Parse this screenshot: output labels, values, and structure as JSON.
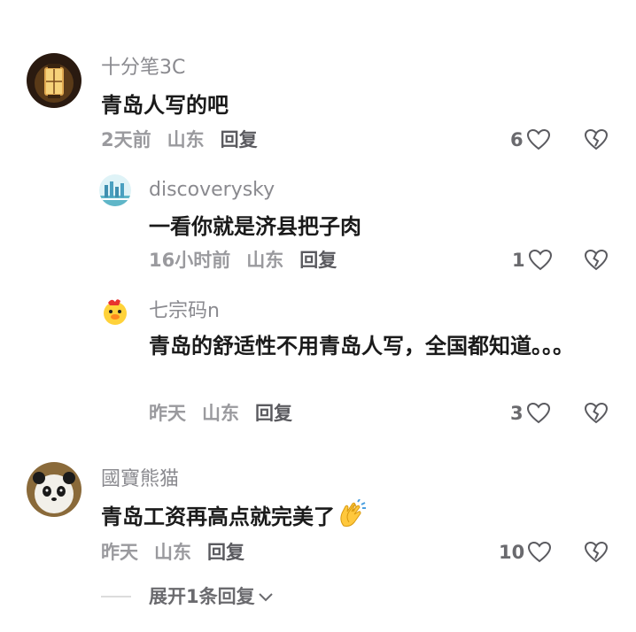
{
  "comments": [
    {
      "username": "十分笔3C",
      "text": "青岛人写的吧",
      "time": "2天前",
      "location": "山东",
      "reply_label": "回复",
      "likes": "6",
      "avatar_icon": "lantern-avatar"
    },
    {
      "username": "discoverysky",
      "text": "一看你就是济县把子肉",
      "time": "16小时前",
      "location": "山东",
      "reply_label": "回复",
      "likes": "1",
      "avatar_icon": "skyline-avatar"
    },
    {
      "username": "七宗码n",
      "text": "青岛的舒适性不用青岛人写，全国都知道。。。",
      "time": "昨天",
      "location": "山东",
      "reply_label": "回复",
      "likes": "3",
      "avatar_icon": "duck-avatar"
    },
    {
      "username": "國寶熊猫",
      "text": "青岛工资再高点就完美了",
      "time": "昨天",
      "location": "山东",
      "reply_label": "回复",
      "likes": "10",
      "avatar_icon": "panda-avatar"
    }
  ],
  "expand_label": "展开1条回复",
  "colors": {
    "text": "#1a1a1a",
    "muted": "#9a9a9e",
    "username": "#8a8a8f"
  },
  "icons": {
    "like": "heart-outline-icon",
    "dislike": "broken-heart-icon",
    "clap": "clapping-hands-emoji",
    "expand": "chevron-down-icon"
  }
}
